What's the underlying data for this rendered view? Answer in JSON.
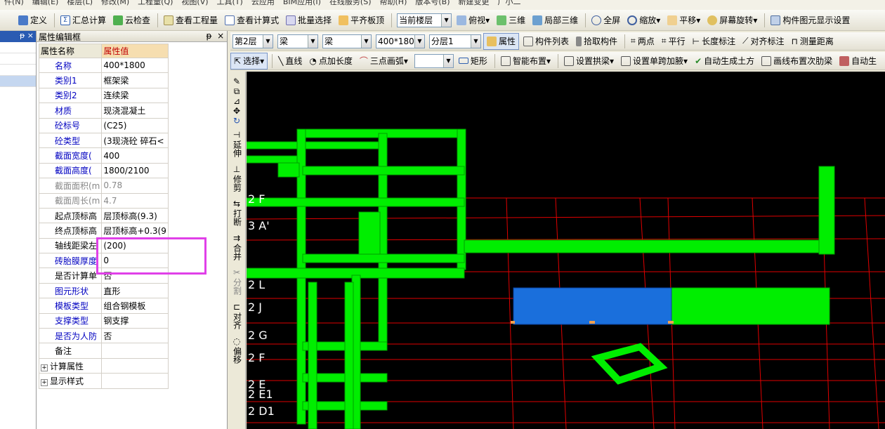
{
  "menu": [
    "件(N)",
    "编辑(E)",
    "楼层(L)",
    "修改(M)",
    "工程量(Q)",
    "视图(V)",
    "工具(T)",
    "云应用",
    "BIM应用(I)",
    "在线服务(S)",
    "帮助(H)",
    "版本号(B)",
    "新建变更",
    "广小二"
  ],
  "toolbar1": {
    "items": [
      "定义",
      "汇总计算",
      "云检查",
      "查看工程量",
      "查看计算式",
      "批量选择",
      "平齐板顶"
    ],
    "floor_select": "当前楼层",
    "view_items": [
      "俯视",
      "三维",
      "局部三维",
      "全屏",
      "缩放",
      "平移",
      "屏幕旋转",
      "构件图元显示设置"
    ]
  },
  "props_panel": {
    "title": "属性编辑框",
    "pin": "ᵽ",
    "close": "×",
    "col_name": "属性名称",
    "col_value": "属性值",
    "rows": [
      {
        "k": "名称",
        "v": "400*1800"
      },
      {
        "k": "类别1",
        "v": "框架梁"
      },
      {
        "k": "类别2",
        "v": "连续梁"
      },
      {
        "k": "材质",
        "v": "现浇混凝土"
      },
      {
        "k": "砼标号",
        "v": "(C25)"
      },
      {
        "k": "砼类型",
        "v": "(3现浇砼 碎石<"
      },
      {
        "k": "截面宽度(",
        "v": "400"
      },
      {
        "k": "截面高度(",
        "v": "1800/2100"
      },
      {
        "k": "截面面积(m",
        "v": "0.78"
      },
      {
        "k": "截面周长(m",
        "v": "4.7"
      },
      {
        "k": "起点顶标高",
        "v": "层顶标高(9.3)"
      },
      {
        "k": "终点顶标高",
        "v": "层顶标高+0.3(9"
      },
      {
        "k": "轴线距梁左",
        "v": "(200)"
      },
      {
        "k": "砖胎膜厚度",
        "v": "0"
      },
      {
        "k": "是否计算单",
        "v": "否"
      },
      {
        "k": "图元形状",
        "v": "直形"
      },
      {
        "k": "模板类型",
        "v": "组合钢模板"
      },
      {
        "k": "支撑类型",
        "v": "钢支撑"
      },
      {
        "k": "是否为人防",
        "v": "否"
      },
      {
        "k": "备注",
        "v": ""
      },
      {
        "k": "计算属性",
        "v": ""
      },
      {
        "k": "显示样式",
        "v": ""
      }
    ]
  },
  "toolbar2": {
    "floor": "第2层",
    "cat1": "梁",
    "cat2": "梁",
    "size": "400*180(",
    "layer": "分层1",
    "attr": "属性",
    "list": "构件列表",
    "pick": "拾取构件",
    "two_points": "两点",
    "parallel": "平行",
    "len_dim": "长度标注",
    "align_dim": "对齐标注",
    "measure": "测量距离"
  },
  "toolbar3": {
    "select": "选择",
    "line": "直线",
    "add_len": "点加长度",
    "arc": "三点画弧",
    "rect": "矩形",
    "smart": "智能布置",
    "arch_beam": "设置拱梁",
    "span_haunch": "设置单跨加腋",
    "auto_soil": "自动生成土方",
    "secondary_rebar": "画线布置次肋梁",
    "auto_gen": "自动生"
  },
  "vtools": [
    "延伸",
    "修剪",
    "打断",
    "合并",
    "分割",
    "对齐",
    "偏移"
  ],
  "axis_labels": [
    "2 F",
    "3 A'",
    "2 L",
    "2 J",
    "2 G",
    "2 F",
    "2 E",
    "2 E1",
    "2 D1"
  ],
  "colors": {
    "beam_green": "#00ee00",
    "beam_selected": "#1a6fdc",
    "grid_red": "#e00000",
    "highlight": "#e040e8"
  }
}
